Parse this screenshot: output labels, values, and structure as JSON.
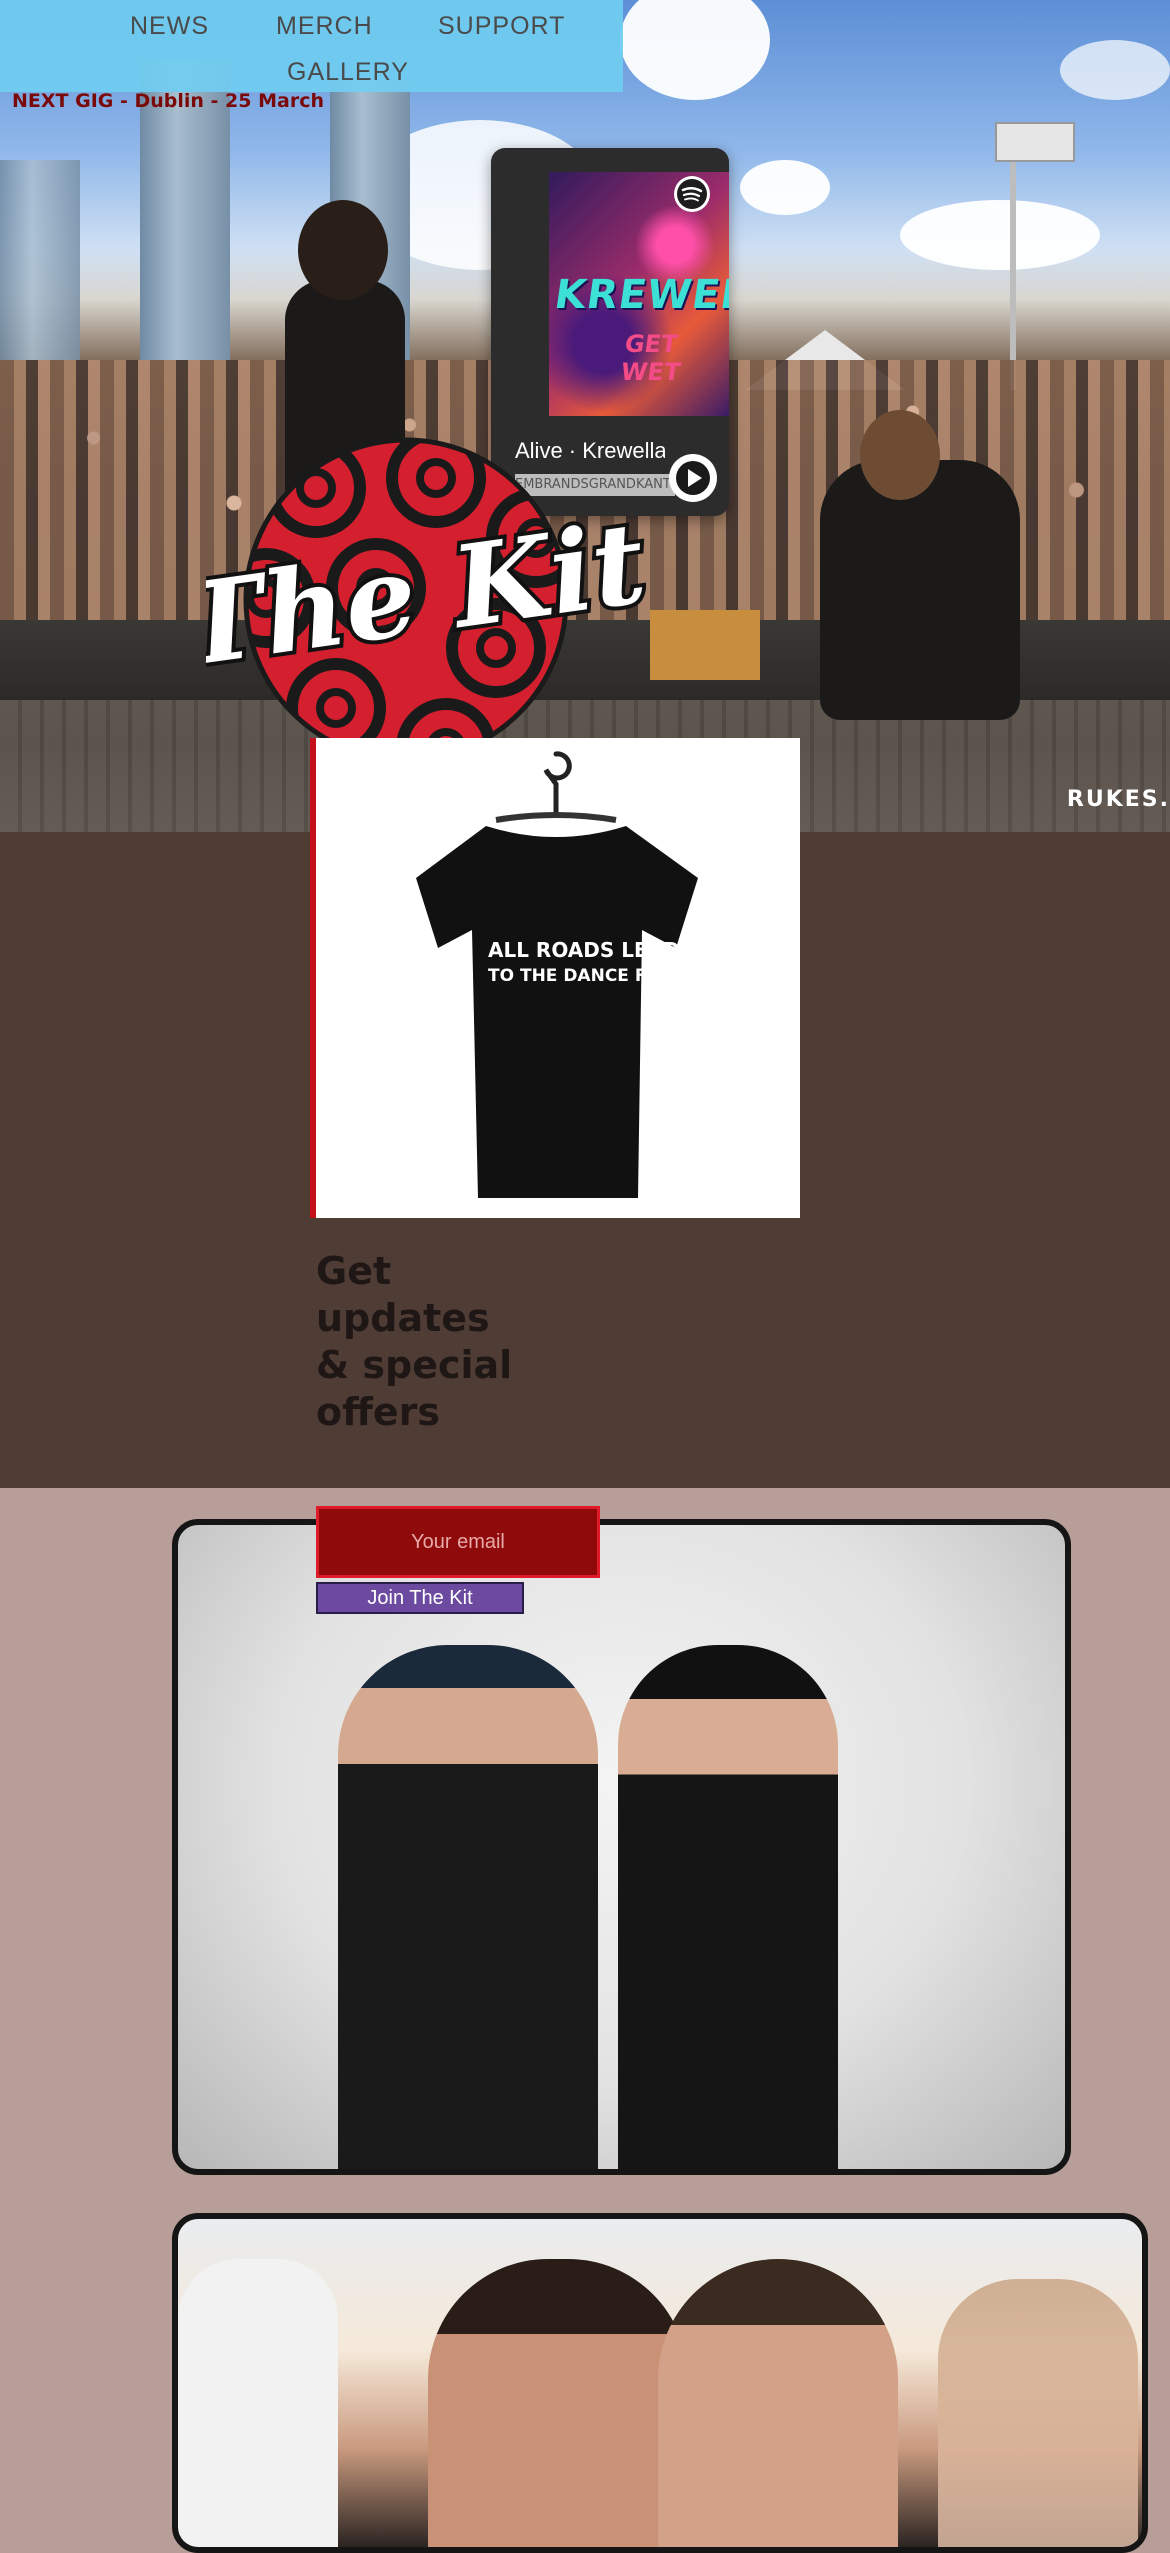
{
  "nav": {
    "items": [
      {
        "label": "NEWS"
      },
      {
        "label": "MERCH"
      },
      {
        "label": "SUPPORT"
      },
      {
        "label": "GALLERY"
      }
    ]
  },
  "announcement": {
    "next_gig": "NEXT GIG - Dublin - 25 March"
  },
  "hero": {
    "photo_credit": "RUKES."
  },
  "player": {
    "cover_title": "KREWELLA",
    "cover_subtitle": "GET WET",
    "track_title": "Alive · Krewella",
    "track_artist": "EMBRANDSGRANDKANT",
    "icon": "spotify-icon",
    "play_icon": "play-icon"
  },
  "logo": {
    "text": "The Kit",
    "colors": {
      "disc": "#d41f2f",
      "rings": "#1a1a1a"
    }
  },
  "merch": {
    "shirt_line_1": "ALL ROADS LEAD",
    "shirt_line_2": "TO THE DANCE FLOOR"
  },
  "signup": {
    "heading": "Get updates & special offers",
    "email_placeholder": "Your email",
    "button_label": "Join The Kit"
  },
  "colors": {
    "nav_bg": "#70cdf1",
    "brown_section": "#4f3c35",
    "pink_section": "#b89e98",
    "email_bg": "#8f0b0b",
    "button_bg": "#6b4aa0"
  }
}
